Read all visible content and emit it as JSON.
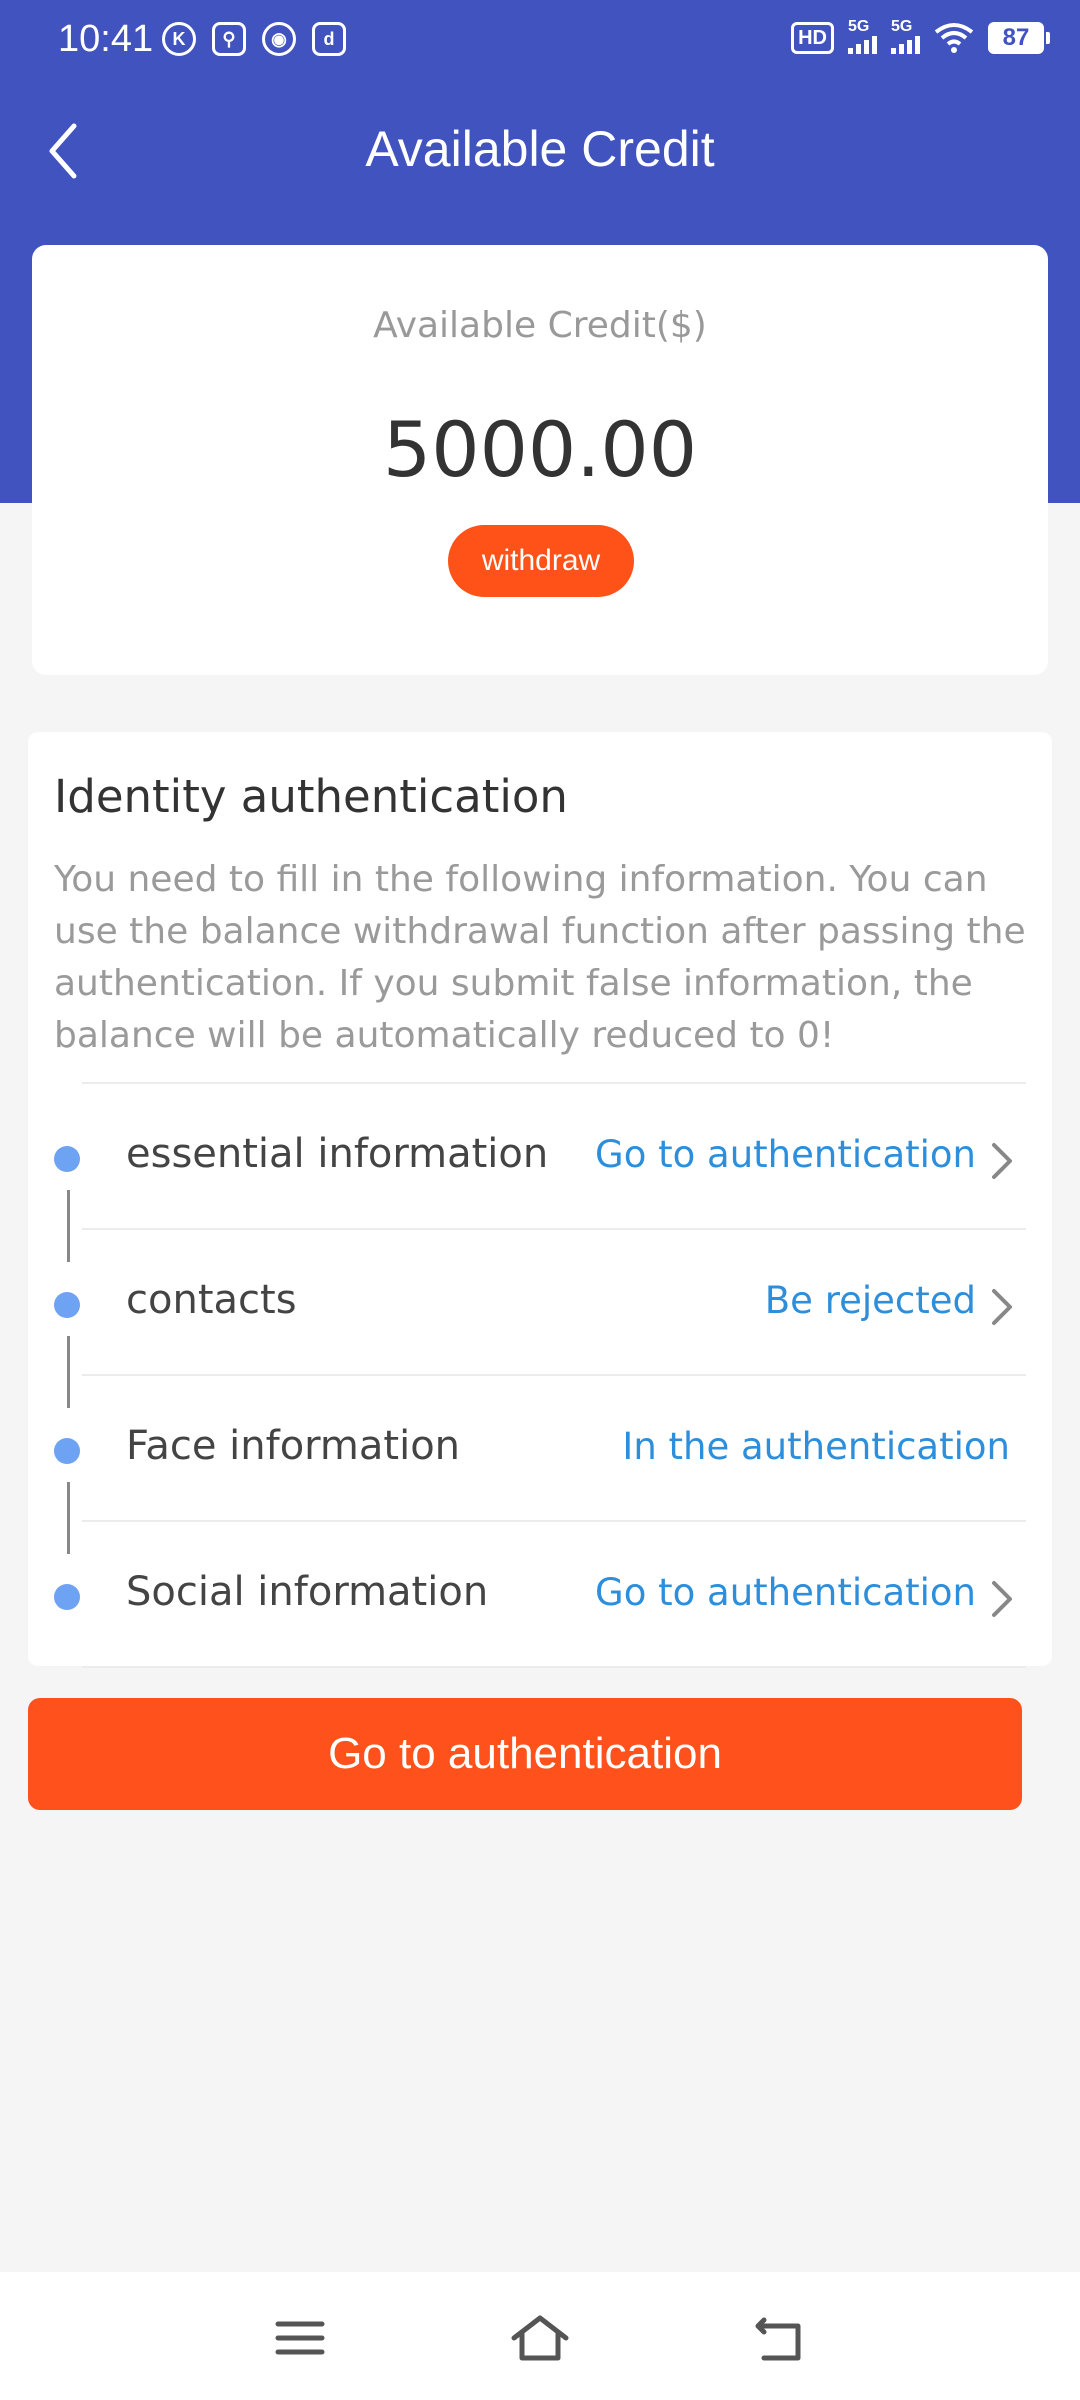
{
  "status_bar": {
    "time": "10:41",
    "left_icons": [
      "k-icon",
      "map-pin-icon",
      "camera-icon",
      "d-app-icon"
    ],
    "hd_label": "HD",
    "signal1_label": "5G",
    "signal2_label": "5G",
    "battery": "87"
  },
  "header": {
    "title": "Available Credit",
    "background_color": "#4053bf"
  },
  "credit": {
    "label": "Available Credit($)",
    "amount": "5000.00",
    "withdraw_label": "withdraw"
  },
  "identity": {
    "title": "Identity authentication",
    "description": "You need to fill in the following information. You can use the balance withdrawal function after passing the authentication. If you submit false information, the balance will be automatically reduced to 0!",
    "steps": [
      {
        "name": "essential information",
        "status": "Go to authentication",
        "has_arrow": true
      },
      {
        "name": "contacts",
        "status": "Be rejected",
        "has_arrow": true
      },
      {
        "name": "Face information",
        "status": "In the authentication",
        "has_arrow": false
      },
      {
        "name": "Social information",
        "status": "Go to authentication",
        "has_arrow": true
      }
    ]
  },
  "main_button": {
    "label": "Go to authentication",
    "color": "#ff511c"
  },
  "system_nav": {
    "icons": [
      "menu-icon",
      "home-icon",
      "back-icon"
    ]
  }
}
